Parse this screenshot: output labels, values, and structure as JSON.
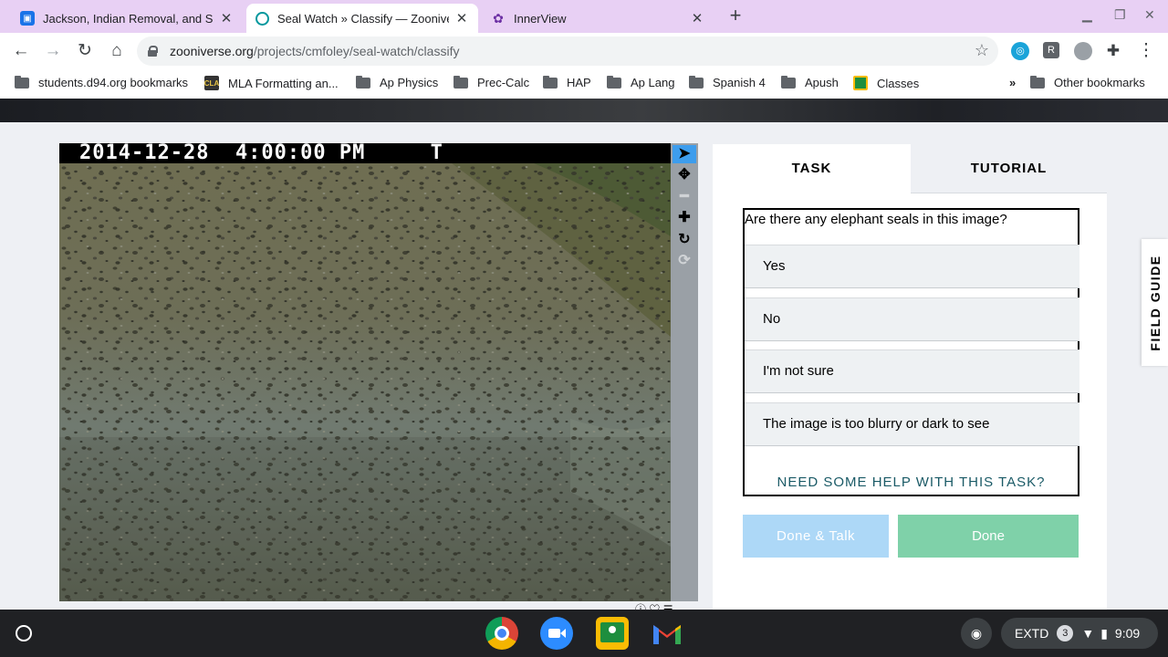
{
  "browser": {
    "tabs": [
      {
        "title": "Jackson, Indian Removal, and Su",
        "favicon": "classroom-icon",
        "color": "#1a73e8"
      },
      {
        "title": "Seal Watch » Classify — Zooniver",
        "favicon": "zooniverse-icon",
        "color": "#00979d"
      },
      {
        "title": "InnerView",
        "favicon": "innerview-icon",
        "color": "#6b2fa3"
      }
    ],
    "address": {
      "host": "zooniverse.org",
      "path": "/projects/cmfoley/seal-watch/classify"
    },
    "bookmarks": [
      {
        "label": "students.d94.org bookmarks",
        "icon": "bookmark-manager-icon"
      },
      {
        "label": "MLA Formatting an...",
        "icon": "cla-icon"
      },
      {
        "label": "Ap Physics",
        "icon": "folder-icon"
      },
      {
        "label": "Prec-Calc",
        "icon": "folder-icon"
      },
      {
        "label": "HAP",
        "icon": "folder-icon"
      },
      {
        "label": "Ap Lang",
        "icon": "folder-icon"
      },
      {
        "label": "Spanish 4",
        "icon": "folder-icon"
      },
      {
        "label": "Apush",
        "icon": "folder-icon"
      },
      {
        "label": "Classes",
        "icon": "classroom-icon"
      }
    ],
    "more_bookmarks": "»",
    "other_bookmarks": "Other bookmarks",
    "extensions": [
      {
        "name": "extension-blue-icon",
        "color": "#1aa3d9"
      },
      {
        "name": "extension-r-icon",
        "letter": "R",
        "color": "#5f6368"
      },
      {
        "name": "extension-grey-icon",
        "color": "#9aa0a6"
      }
    ]
  },
  "viewer": {
    "timestamp": "2014-12-28  4:00:00 PM     T",
    "tools": [
      "pointer-tool",
      "move-tool",
      "zoom-out-tool",
      "zoom-in-tool",
      "rotate-tool",
      "reset-tool"
    ]
  },
  "task_panel": {
    "tabs": {
      "task": "TASK",
      "tutorial": "TUTORIAL"
    },
    "question": "Are there any elephant seals in this image?",
    "answers": [
      "Yes",
      "No",
      "I'm not sure",
      "The image is too blurry or dark to see"
    ],
    "help": "NEED SOME HELP WITH THIS TASK?",
    "buttons": {
      "done_talk": "Done & Talk",
      "done": "Done"
    }
  },
  "field_guide": "FIELD GUIDE",
  "shelf": {
    "apps": [
      "chrome-icon",
      "zoom-icon",
      "google-classroom-icon",
      "gmail-icon"
    ],
    "display_mode": "EXTD",
    "notifications": "3",
    "time": "9:09"
  }
}
